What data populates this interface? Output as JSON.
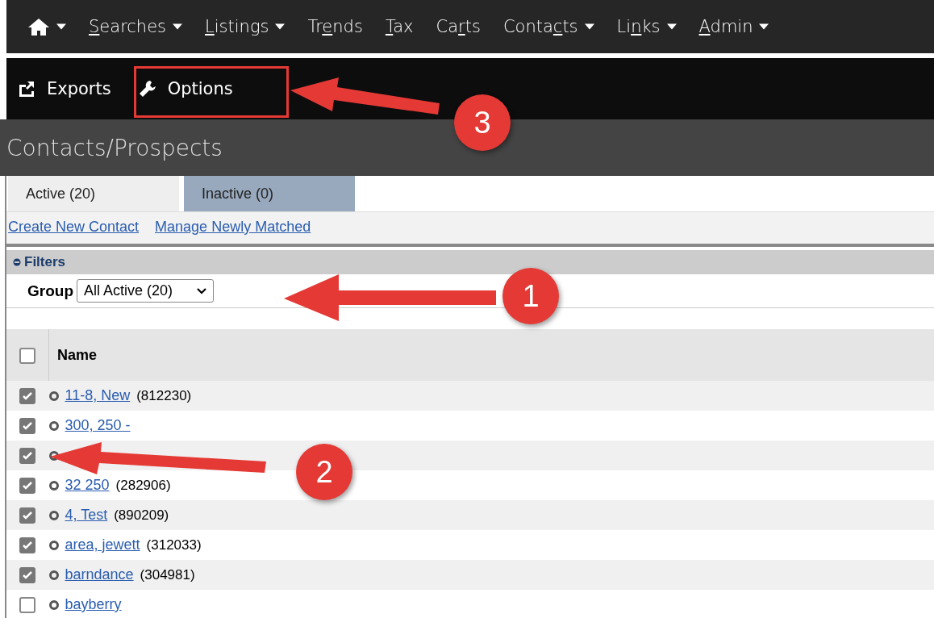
{
  "nav": {
    "items": [
      {
        "kind": "home",
        "dropdown": true
      },
      {
        "kind": "text",
        "key": "S",
        "post": "earches",
        "dropdown": true
      },
      {
        "kind": "text",
        "key": "L",
        "post": "istings",
        "dropdown": true
      },
      {
        "kind": "text",
        "pre": "Tr",
        "key": "e",
        "post": "nds",
        "dropdown": false
      },
      {
        "kind": "text",
        "key": "T",
        "post": "ax",
        "dropdown": false
      },
      {
        "kind": "text",
        "pre": "Ca",
        "key": "r",
        "post": "ts",
        "dropdown": false
      },
      {
        "kind": "text",
        "pre": "Conta",
        "key": "c",
        "post": "ts",
        "dropdown": true
      },
      {
        "kind": "text",
        "pre": "Li",
        "key": "n",
        "post": "ks",
        "dropdown": true
      },
      {
        "kind": "text",
        "key": "A",
        "post": "dmin",
        "dropdown": true
      }
    ]
  },
  "toolbar": [
    {
      "kind": "export",
      "label": "Exports"
    },
    {
      "kind": "wrench",
      "label": "Options"
    }
  ],
  "page_title": "Contacts/Prospects",
  "tabs": [
    {
      "label": "Active (20)",
      "selected": true
    },
    {
      "label": "Inactive (0)",
      "selected": false
    }
  ],
  "links": [
    "Create New Contact",
    "Manage Newly Matched"
  ],
  "filters": {
    "title": "Filters",
    "group_label": "Group",
    "group_value": "All Active (20)"
  },
  "table": {
    "columns": [
      "Name"
    ],
    "all_checked": false,
    "rows": [
      {
        "checked": true,
        "name": "11-8, New",
        "id": "(812230)"
      },
      {
        "checked": true,
        "name": "300, 250 -"
      },
      {
        "checked": true
      },
      {
        "checked": true,
        "name": "32 250",
        "id": "(282906)"
      },
      {
        "checked": true,
        "name": "4, Test",
        "id": "(890209)"
      },
      {
        "checked": true,
        "name": "area, jewett",
        "id": "(312033)"
      },
      {
        "checked": true,
        "name": "barndance",
        "id": "(304981)"
      },
      {
        "checked": false,
        "name": "bayberry"
      }
    ]
  },
  "annotations": [
    {
      "label": "3"
    },
    {
      "label": "1"
    },
    {
      "label": "2"
    }
  ]
}
